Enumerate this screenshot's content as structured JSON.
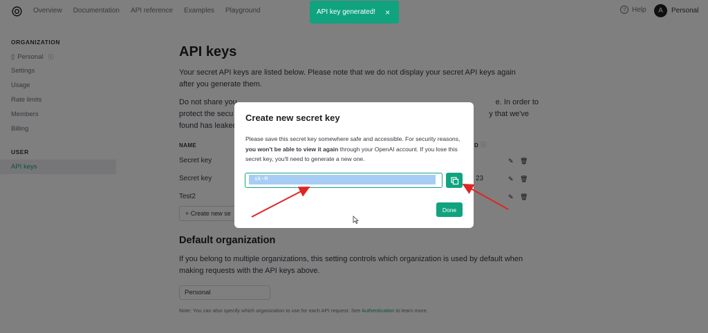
{
  "nav": {
    "links": [
      "Overview",
      "Documentation",
      "API reference",
      "Examples",
      "Playground"
    ],
    "help": "Help",
    "account_initial": "A",
    "account_name": "Personal"
  },
  "toast": {
    "text": "API key generated!",
    "close": "×"
  },
  "sidebar": {
    "org_section": "ORGANIZATION",
    "org_items": [
      "Personal",
      "Settings",
      "Usage",
      "Rate limits",
      "Members",
      "Billing"
    ],
    "user_section": "USER",
    "user_items": [
      "API keys"
    ]
  },
  "main": {
    "title": "API keys",
    "intro": "Your secret API keys are listed below. Please note that we do not display your secret API keys again after you generate them.",
    "warning_line1": "Do not share you",
    "warning_line1_end": "e. In order to",
    "warning_line2": "protect the secu",
    "warning_line2_end": "y that we've",
    "warning_line3": "found has leaked",
    "table": {
      "col_name": "NAME",
      "col_partial": "D",
      "rows": [
        {
          "name": "Secret key",
          "extra": ""
        },
        {
          "name": "Secret key",
          "extra": "23"
        },
        {
          "name": "Test2",
          "extra": ""
        }
      ]
    },
    "create_button": "+ Create new se",
    "default_org_title": "Default organization",
    "default_org_desc": "If you belong to multiple organizations, this setting controls which organization is used by default when making requests with the API keys above.",
    "org_select_value": "Personal",
    "note_prefix": "Note: You can also specify which organization to use for each API request. See ",
    "note_link": "Authentication",
    "note_suffix": " to learn more."
  },
  "modal": {
    "title": "Create new secret key",
    "desc_pre": "Please save this secret key somewhere safe and accessible. For security reasons, ",
    "desc_bold": "you won't be able to view it again",
    "desc_post": " through your OpenAI account. If you lose this secret key, you'll need to generate a new one.",
    "key_value": "sk-M",
    "done_label": "Done"
  },
  "colors": {
    "accent": "#10a37f",
    "arrow": "#e02424"
  },
  "icons": [
    "openai-logo-icon",
    "help-icon",
    "copy-icon",
    "edit-icon",
    "trash-icon",
    "cursor-icon"
  ]
}
